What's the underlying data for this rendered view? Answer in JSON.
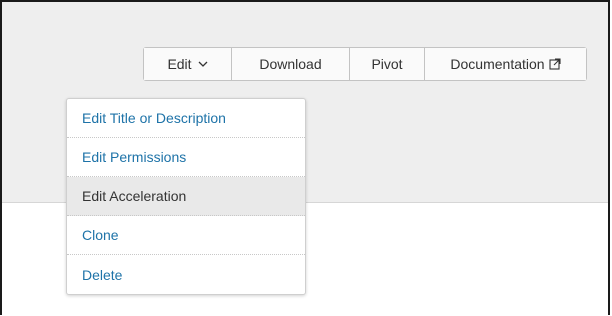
{
  "toolbar": {
    "edit_label": "Edit",
    "download_label": "Download",
    "pivot_label": "Pivot",
    "documentation_label": "Documentation"
  },
  "icons": {
    "edit_dropdown": "chevron-down-icon",
    "documentation": "external-link-icon"
  },
  "edit_menu": {
    "items": [
      {
        "label": "Edit Title or Description"
      },
      {
        "label": "Edit Permissions"
      },
      {
        "label": "Edit Acceleration",
        "highlighted": true
      },
      {
        "label": "Clone"
      },
      {
        "label": "Delete"
      }
    ]
  },
  "colors": {
    "link": "#1e73a8",
    "header_background": "#eeeeee",
    "highlight": "#e9e9e9"
  }
}
